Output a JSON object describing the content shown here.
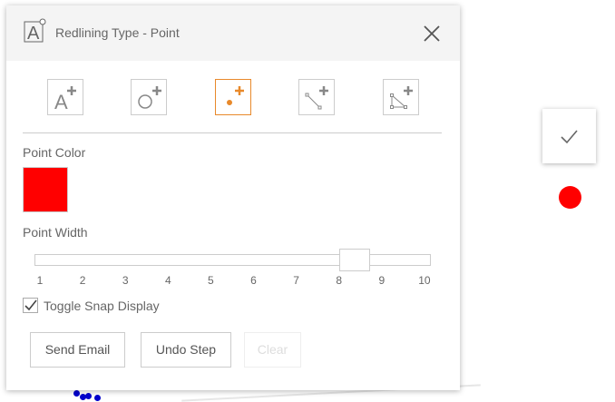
{
  "dialog": {
    "title": "Redlining Type - Point",
    "tools": [
      {
        "name": "text-tool",
        "active": false
      },
      {
        "name": "circle-tool",
        "active": false
      },
      {
        "name": "point-tool",
        "active": true
      },
      {
        "name": "line-tool",
        "active": false
      },
      {
        "name": "polygon-tool",
        "active": false
      }
    ],
    "point_color_label": "Point Color",
    "point_color": "#ff0000",
    "point_width_label": "Point Width",
    "point_width_value": 8,
    "slider_ticks": [
      "1",
      "2",
      "3",
      "4",
      "5",
      "6",
      "7",
      "8",
      "9",
      "10"
    ],
    "snap_label": "Toggle Snap Display",
    "snap_checked": true,
    "buttons": {
      "send_email": "Send Email",
      "undo_step": "Undo Step",
      "clear": "Clear"
    }
  },
  "colors": {
    "accent": "#e8892b",
    "map_point": "#ff0000",
    "snap_points": "#0000cc"
  }
}
